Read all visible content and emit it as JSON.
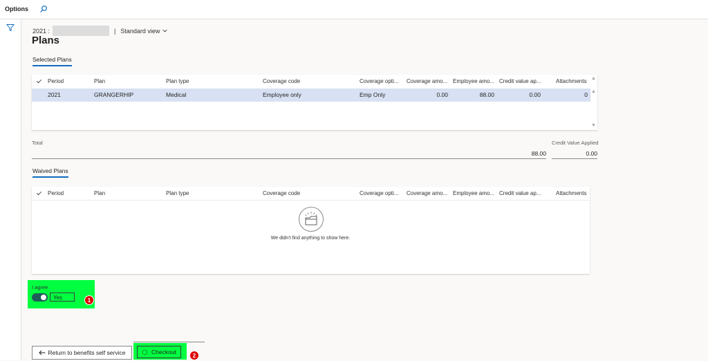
{
  "topbar": {
    "options_label": "Options",
    "search_icon": "search-icon"
  },
  "leftrail": {
    "filter_icon": "filter-icon"
  },
  "breadcrumb": {
    "year": "2021 :",
    "separator": "|",
    "view": "Standard view"
  },
  "page": {
    "title": "Plans"
  },
  "selected_plans": {
    "section_label": "Selected Plans",
    "columns": [
      "Period",
      "Plan",
      "Plan type",
      "Coverage code",
      "Coverage opti...",
      "Coverage amo...",
      "Employee amo...",
      "Credit value ap...",
      "Attachments"
    ],
    "rows": [
      {
        "period": "2021",
        "plan": "GRANGERHIP",
        "plan_type": "Medical",
        "coverage_code": "Employee only",
        "coverage_option": "Emp Only",
        "coverage_amount": "0.00",
        "employee_amount": "88.00",
        "credit_value": "0.00",
        "attachments": "0"
      }
    ]
  },
  "totals": {
    "total_label": "Total",
    "total_value": "88.00",
    "credit_label": "Credit Value Applied",
    "credit_value": "0.00"
  },
  "waived_plans": {
    "section_label": "Waived Plans",
    "columns": [
      "Period",
      "Plan",
      "Plan type",
      "Coverage code",
      "Coverage opti...",
      "Coverage amo...",
      "Employee amo...",
      "Credit value ap...",
      "Attachments"
    ],
    "empty_message": "We didn't find anything to show here."
  },
  "agree": {
    "label": "I agree",
    "value": "Yes",
    "enabled": true
  },
  "badges": {
    "one": "1",
    "two": "2"
  },
  "actions": {
    "return_label": "Return to benefits self service",
    "checkout_label": "Checkout"
  },
  "colors": {
    "highlight": "#00ff40",
    "selected_row": "#d8e1f3",
    "accent": "#0f6cbd",
    "badge": "#e00000",
    "toggle": "#1e5d5a"
  }
}
